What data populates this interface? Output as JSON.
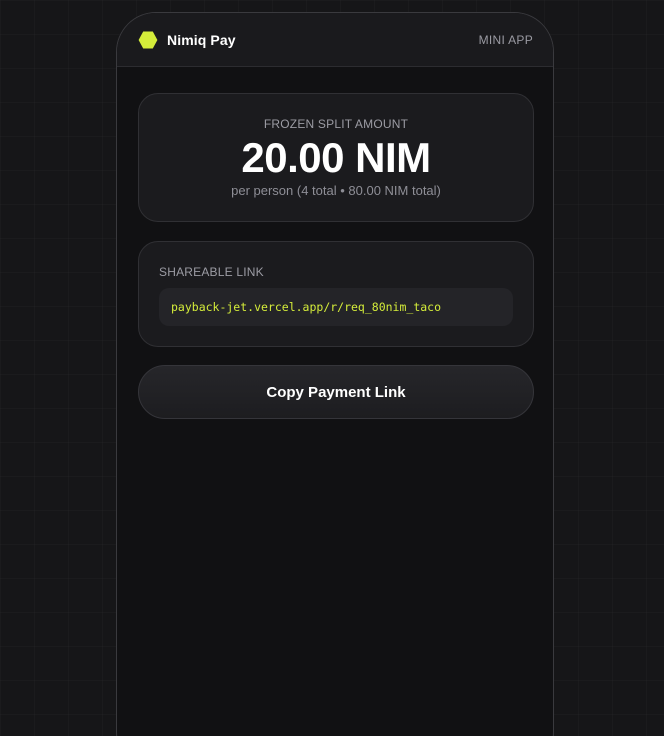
{
  "app": {
    "brand_name": "Nimiq Pay",
    "tag": "MINI APP",
    "logo_icon": "hexagon-icon",
    "accent_color": "#d4ec3a"
  },
  "amount_card": {
    "label": "FROZEN SPLIT AMOUNT",
    "value": "20.00 NIM",
    "subtext": "per person (4 total • 80.00 NIM total)"
  },
  "link_card": {
    "label": "SHAREABLE LINK",
    "url": "payback-jet.vercel.app/r/req_80nim_taco"
  },
  "actions": {
    "copy_label": "Copy Payment Link"
  }
}
